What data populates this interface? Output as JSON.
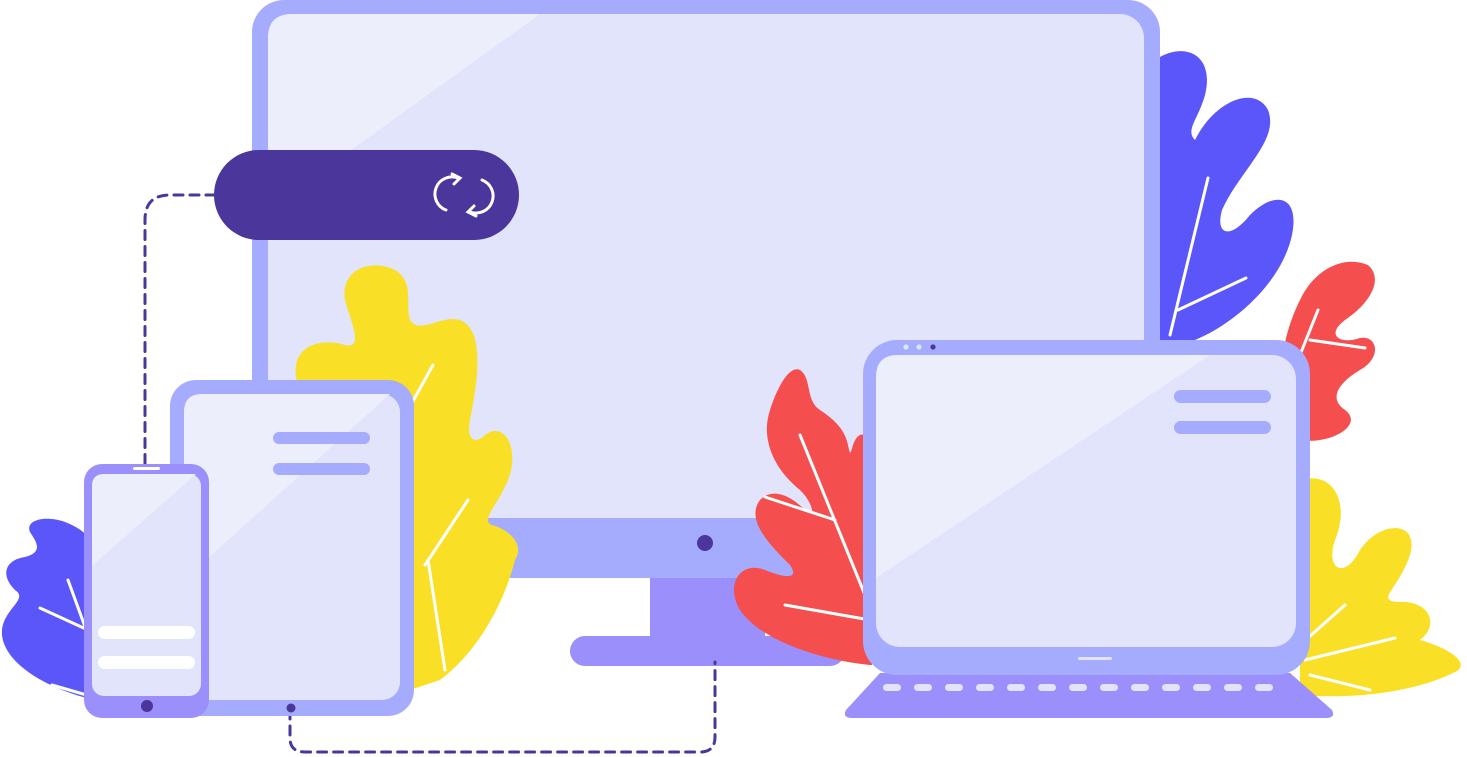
{
  "scene": {
    "devices": [
      "desktop-monitor",
      "tablet",
      "smartphone",
      "laptop"
    ],
    "sync_bar": {
      "label": "",
      "icon": "sync-icon"
    },
    "connections": "dashed-lines"
  },
  "colors": {
    "background": "#ffffff",
    "device_frame": "#a6acfd",
    "device_frame_dark": "#9b8ffb",
    "screen": "#e1e4fb",
    "screen_highlight": "#eceefc",
    "sync_bar": "#4b369b",
    "dashed_line": "#4b369b",
    "leaf_blue": "#5b56f9",
    "leaf_red": "#f44e4e",
    "leaf_yellow": "#f9df26",
    "content_line": "#a6acfd",
    "white": "#ffffff"
  }
}
